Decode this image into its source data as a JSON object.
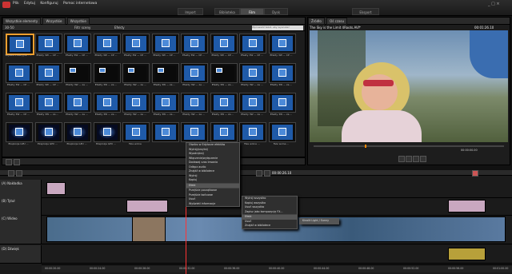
{
  "menu": [
    "Plik",
    "Edytuj",
    "Konfiguruj",
    "Pomoc internetowa"
  ],
  "top_tabs": {
    "import": "Import",
    "library": "Biblioteka",
    "film": "Film",
    "disk": "Dysk",
    "export": "Eksport"
  },
  "library": {
    "tabs": [
      "Wszystkie elementy",
      "Wszystkie",
      "Wszystkie"
    ],
    "path": "30-50",
    "filter_label": "Filtr sceny",
    "all_label": "Efekty",
    "search_placeholder": "Wprowadź tekst, aby wyszukać",
    "thumbs": [
      {
        "cap": "Szybkie kreacyjne - ...",
        "kind": "sel"
      },
      {
        "cap": "Efekty 3W — CP ...",
        "kind": ""
      },
      {
        "cap": "Efekty 3W — CP ...",
        "kind": ""
      },
      {
        "cap": "Efekty 3W — CP ...",
        "kind": ""
      },
      {
        "cap": "Efekty 3W — CP ...",
        "kind": ""
      },
      {
        "cap": "Efekty 3W — CP ...",
        "kind": ""
      },
      {
        "cap": "Efekty 3W — CP ...",
        "kind": ""
      },
      {
        "cap": "Efekty 3W — CP ...",
        "kind": ""
      },
      {
        "cap": "Efekty 3W — CP ...",
        "kind": ""
      },
      {
        "cap": "Efekty 3W — CP ...",
        "kind": ""
      },
      {
        "cap": "Efekty 3W — CP ...",
        "kind": ""
      },
      {
        "cap": "Efekty 3W — CP ...",
        "kind": ""
      },
      {
        "cap": "Efekty 3W — za ...",
        "kind": "dark"
      },
      {
        "cap": "Efekty 3W — za ...",
        "kind": "dark"
      },
      {
        "cap": "Efekty 3W — za ...",
        "kind": "dark"
      },
      {
        "cap": "Efekty 3W — za ...",
        "kind": "dark"
      },
      {
        "cap": "Efekty 3W — za ...",
        "kind": ""
      },
      {
        "cap": "Efekty 3W — za ...",
        "kind": "dark"
      },
      {
        "cap": "Efekty 3W — za ...",
        "kind": ""
      },
      {
        "cap": "Efekty 3W — za ...",
        "kind": ""
      },
      {
        "cap": "Efekty 3W — CP ...",
        "kind": ""
      },
      {
        "cap": "Efekty 3W — za ...",
        "kind": ""
      },
      {
        "cap": "Efekty 3W — za ...",
        "kind": ""
      },
      {
        "cap": "Efekty 3W — za ...",
        "kind": ""
      },
      {
        "cap": "Efekty 3W — za ...",
        "kind": ""
      },
      {
        "cap": "Efekty 3W — za ...",
        "kind": ""
      },
      {
        "cap": "Efekty 3W — za ...",
        "kind": ""
      },
      {
        "cap": "Efekty 3W — za ...",
        "kind": ""
      },
      {
        "cap": "Efekty 3W — za ...",
        "kind": ""
      },
      {
        "cap": "Efekty 3W — za ...",
        "kind": ""
      },
      {
        "cap": "Eksplozje GPU ...",
        "kind": "stars"
      },
      {
        "cap": "Eksplozje GPU ...",
        "kind": "stars"
      },
      {
        "cap": "Eksplozje GPU ...",
        "kind": "stars"
      },
      {
        "cap": "Eksplozje GPU ...",
        "kind": "stars"
      },
      {
        "cap": "Fale wolne",
        "kind": ""
      },
      {
        "cap": "",
        "kind": ""
      },
      {
        "cap": "",
        "kind": ""
      },
      {
        "cap": "",
        "kind": ""
      },
      {
        "cap": "Fale wolne ...",
        "kind": ""
      },
      {
        "cap": "Fale wolne ...",
        "kind": ""
      }
    ]
  },
  "player": {
    "tabs": [
      "Źródło",
      "Oś czasu"
    ],
    "title": "The Sky is the Limit 4Roots.AVI*",
    "timecode": "00:01:26.10",
    "time_end": "00:00:00.00"
  },
  "timeline": {
    "timecode": "00:00:26.10",
    "tracks": [
      "(A) Nakładka",
      "(B) Tytuł",
      "(C) Wideo",
      "(D) Dźwięk"
    ],
    "ruler": [
      "00:00:20.00",
      "00:00:24.00",
      "00:00:28.00",
      "00:00:32.00",
      "00:00:36.00",
      "00:00:40.00",
      "00:00:44.00",
      "00:00:48.00",
      "00:00:52.00",
      "00:00:56.00",
      "00:01:00.00"
    ]
  },
  "context_menu": [
    "Otwórz w Edytorze efektów",
    "Wytnij/przytnij",
    "Wyodrębnij",
    "Włączenie/wyłączenie",
    "Dodawaj czas trwania",
    "Odłącz audio",
    "Znajdź w bibliotece",
    "Wytnij",
    "Kopiuj",
    "Efekt",
    "Przejście początkowe",
    "Przejście końcowe",
    "Usuń",
    "Wyświetl informacje"
  ],
  "submenu_1": [
    "Wytnij wszystko",
    "Kopiuj wszystko",
    "Usuń wszystko",
    "Zapisz jako kompozycję FX...",
    "Efekt",
    "Usuń",
    "Znajdź w bibliotece"
  ],
  "submenu_2": [
    "Kinolit Light / Sunny"
  ]
}
